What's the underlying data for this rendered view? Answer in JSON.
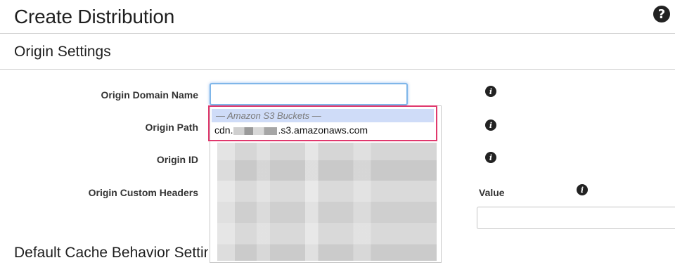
{
  "header": {
    "title": "Create Distribution",
    "help_icon": "?"
  },
  "origin_settings": {
    "title": "Origin Settings",
    "fields": {
      "domain_name_label": "Origin Domain Name",
      "path_label": "Origin Path",
      "id_label": "Origin ID",
      "custom_headers_label": "Origin Custom Headers",
      "value_label": "Value",
      "domain_name_value": ""
    },
    "info_icon": "i"
  },
  "dropdown": {
    "group_label": "— Amazon S3 Buckets —",
    "option_prefix": "cdn.",
    "option_suffix": ".s3.amazonaws.com",
    "highlight_color": "#e0386d"
  },
  "cache_behavior": {
    "title": "Default Cache Behavior Settings"
  }
}
